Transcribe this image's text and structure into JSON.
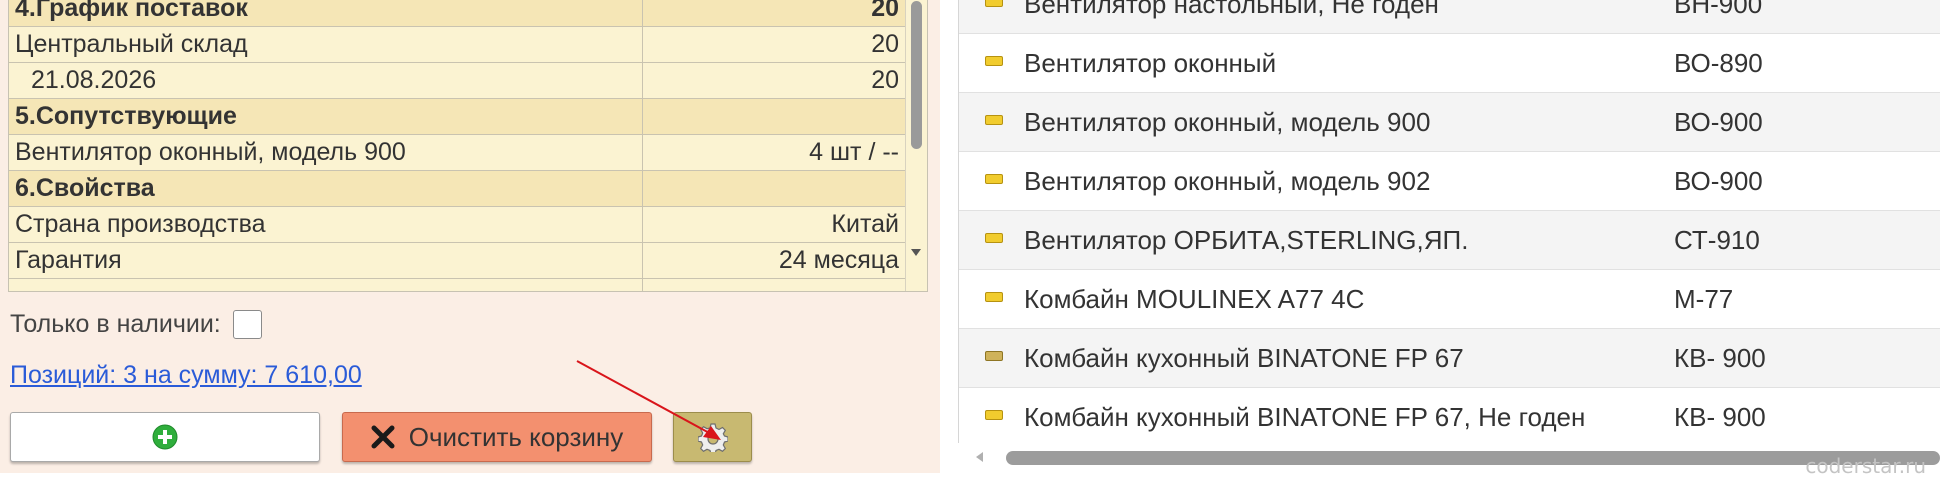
{
  "properties_table": {
    "rows": [
      {
        "kind": "group",
        "name": "4.График поставок",
        "value": "20"
      },
      {
        "kind": "item",
        "name": "Центральный склад",
        "value": "20"
      },
      {
        "kind": "sub",
        "name": "21.08.2026",
        "value": "20"
      },
      {
        "kind": "group",
        "name": "5.Сопутствующие",
        "value": ""
      },
      {
        "kind": "item",
        "name": "Вентилятор оконный, модель 900",
        "value": "4 шт / --"
      },
      {
        "kind": "group",
        "name": "6.Свойства",
        "value": ""
      },
      {
        "kind": "item",
        "name": "Страна производства",
        "value": "Китай"
      },
      {
        "kind": "item",
        "name": "Гарантия",
        "value": "24 месяца"
      }
    ]
  },
  "filters": {
    "only_in_stock_label": "Только в наличии:",
    "only_in_stock_checked": false
  },
  "summary": {
    "link_text": "Позиций: 3 на сумму: 7 610,00"
  },
  "buttons": {
    "add_icon": "plus-circle-icon",
    "clear_label": "Очистить корзину",
    "clear_icon": "x-icon",
    "settings_icon": "gear-icon"
  },
  "products": [
    {
      "name": "Вентилятор настольный, Не годен",
      "code": "ВН-900",
      "icon": "item-icon"
    },
    {
      "name": "Вентилятор оконный",
      "code": "ВО-890",
      "icon": "item-icon"
    },
    {
      "name": "Вентилятор оконный, модель 900",
      "code": "ВО-900",
      "icon": "item-icon"
    },
    {
      "name": "Вентилятор оконный, модель 902",
      "code": "ВО-900",
      "icon": "item-icon"
    },
    {
      "name": "Вентилятор ОРБИТА,STERLING,ЯП.",
      "code": "СТ-910",
      "icon": "item-icon"
    },
    {
      "name": "Комбайн MOULINEX  A77 4C",
      "code": "М-77",
      "icon": "item-icon"
    },
    {
      "name": "Комбайн кухонный BINATONE FP 67",
      "code": "КВ- 900",
      "icon": "item-icon-dark"
    },
    {
      "name": "Комбайн кухонный BINATONE FP 67, Не годен",
      "code": "КВ- 900",
      "icon": "item-icon"
    }
  ],
  "watermark": "coderstar.ru",
  "colors": {
    "group_row": "#f5e6b6",
    "item_row": "#fbf3d2",
    "clear_button": "#f3906f",
    "settings_button": "#c8b971",
    "link": "#2a5bd8",
    "annotation_arrow": "#d9151b",
    "add_icon": "#2fae3c"
  }
}
